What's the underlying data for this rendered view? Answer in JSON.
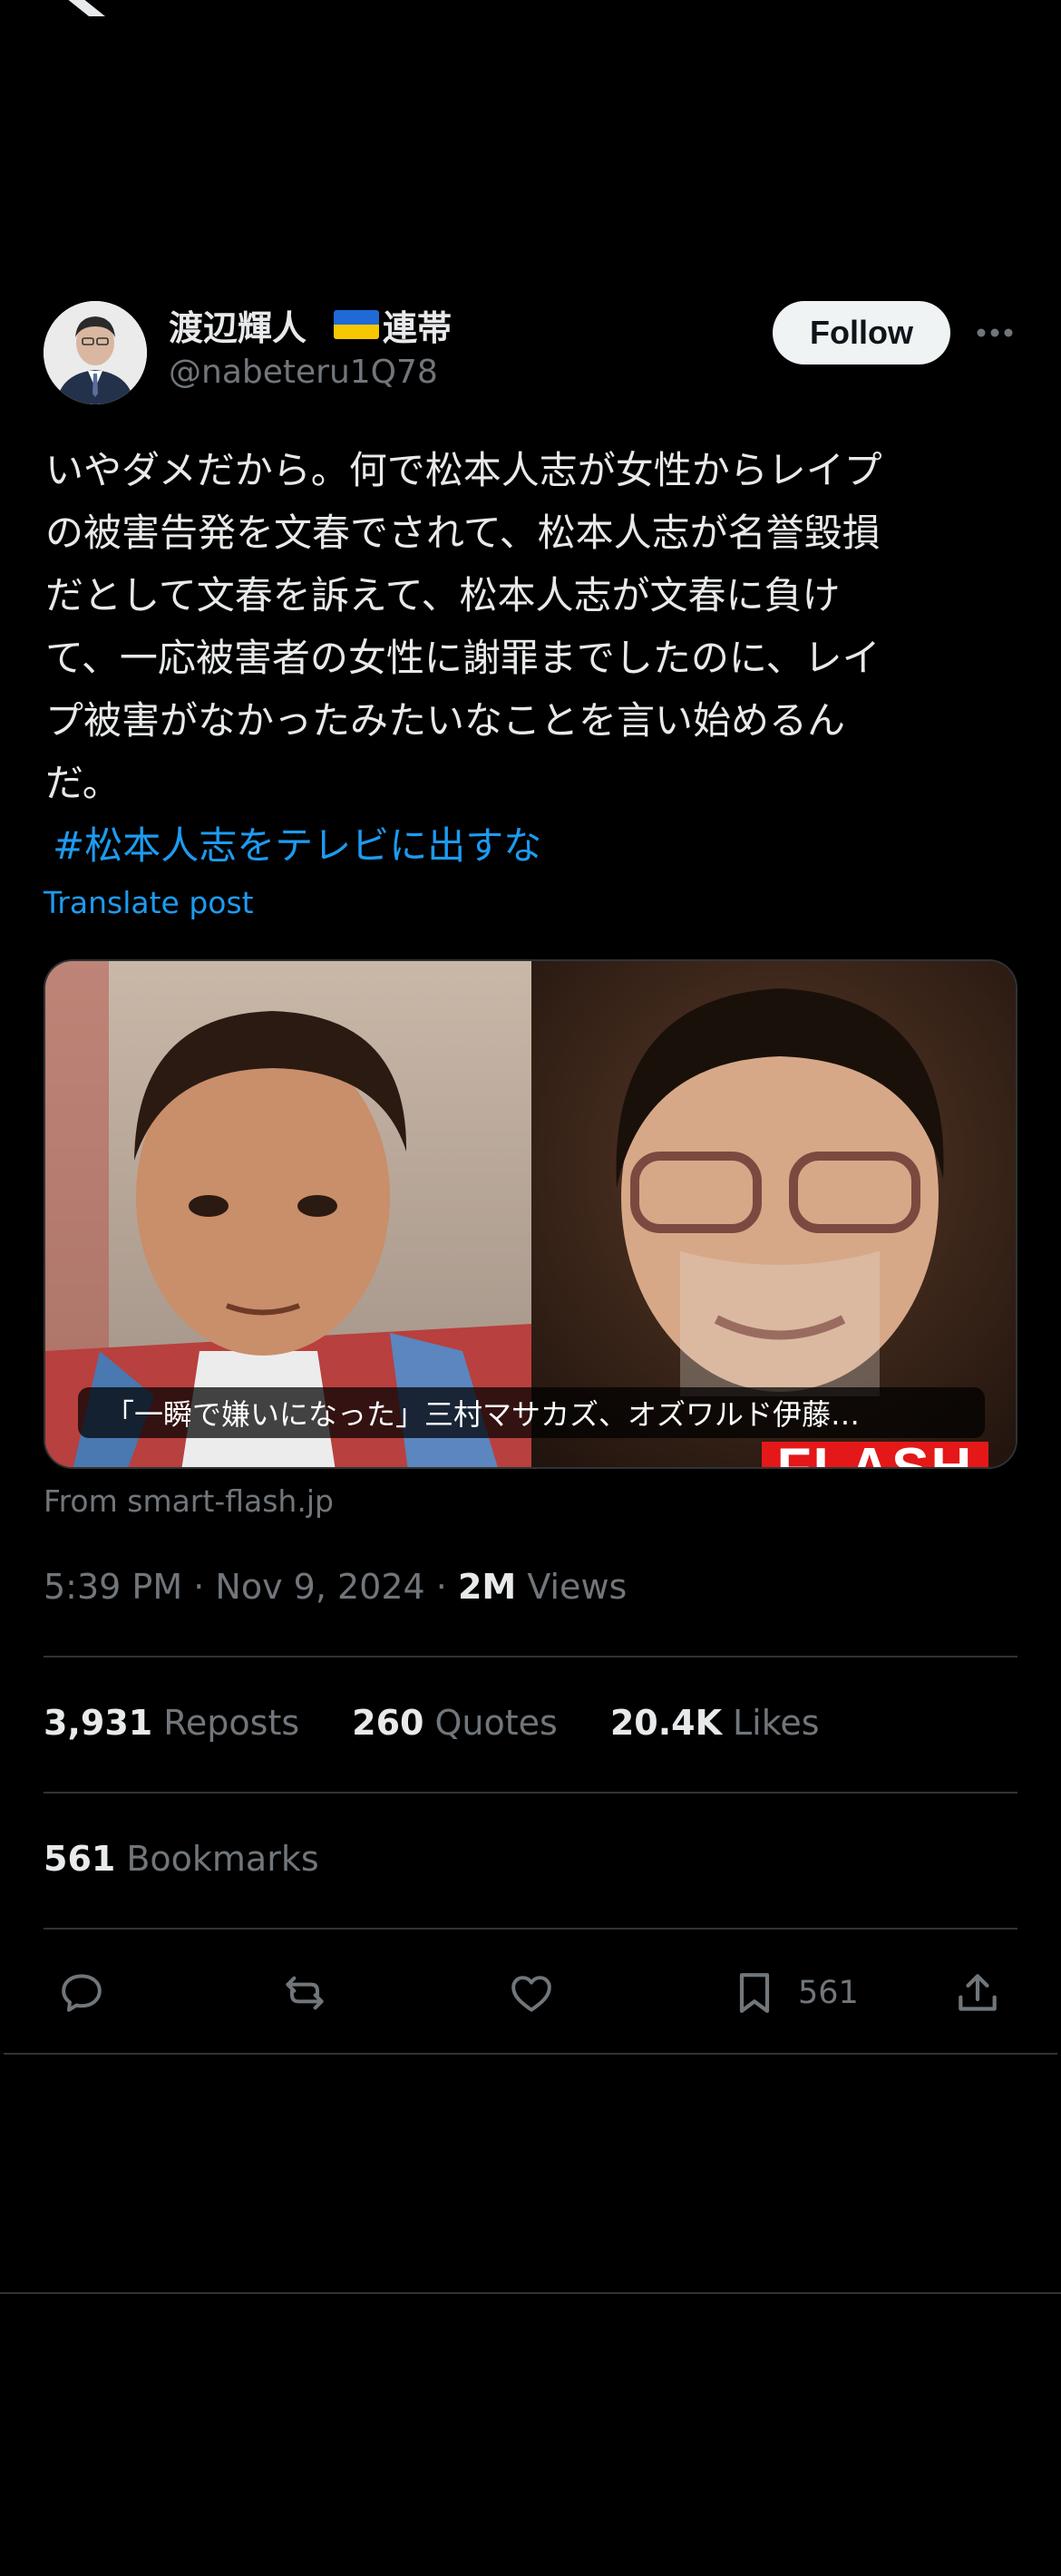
{
  "app": {
    "logo_icon": "x-logo-icon"
  },
  "author": {
    "display_name": "渡辺輝人",
    "flag_icon": "ukraine-flag-icon",
    "tagline": "連帯",
    "handle": "@nabeteru1Q78",
    "follow_label": "Follow",
    "more_icon": "more-dots-icon"
  },
  "post": {
    "text": "いやダメだから。何で松本人志が女性からレイプ\nの被害告発を文春でされて、松本人志が名誉毀損\nだとして文春を訴えて、松本人志が文春に負け\nて、一応被害者の女性に謝罪までしたのに、レイ\nプ被害がなかったみたいなことを言い始めるん\nだ。",
    "hashtag": "#松本人志をテレビに出すな",
    "translate_label": "Translate post"
  },
  "link_card": {
    "caption": "「一瞬で嫌いになった」三村マサカズ、オズワルド伊藤…",
    "brand_text": "FLASH",
    "source": "From smart-flash.jp"
  },
  "meta": {
    "time": "5:39 PM",
    "separator": "·",
    "date": "Nov 9, 2024",
    "views_count": "2M",
    "views_label": "Views"
  },
  "stats": {
    "reposts": {
      "count": "3,931",
      "label": "Reposts"
    },
    "quotes": {
      "count": "260",
      "label": "Quotes"
    },
    "likes": {
      "count": "20.4K",
      "label": "Likes"
    },
    "bookmarks": {
      "count": "561",
      "label": "Bookmarks"
    }
  },
  "actions": {
    "reply_icon": "reply-icon",
    "repost_icon": "repost-icon",
    "like_icon": "heart-icon",
    "bookmark_icon": "bookmark-icon",
    "bookmark_count": "561",
    "share_icon": "share-icon"
  },
  "colors": {
    "background": "#000000",
    "text_primary": "#e7e9ea",
    "text_secondary": "#71767b",
    "link": "#1d9bf0",
    "divider": "#2f3336",
    "follow_bg": "#eff3f4"
  }
}
